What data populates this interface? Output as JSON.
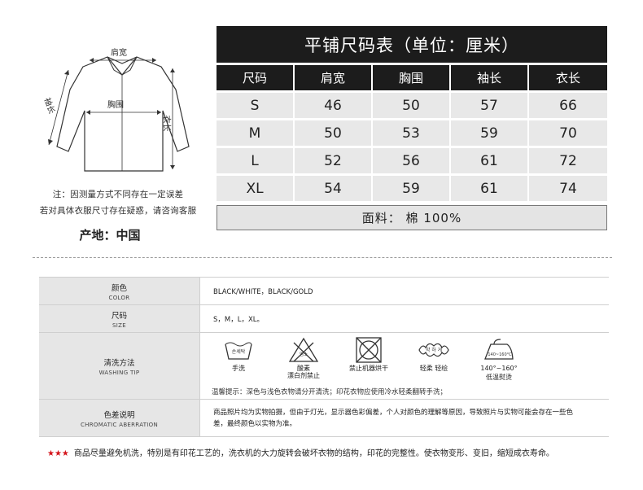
{
  "diagram": {
    "shoulder_label": "肩宽",
    "sleeve_label": "袖长",
    "chest_label": "胸围",
    "length_label": "衣长"
  },
  "notes": {
    "line1": "注：因测量方式不同存在一定误差",
    "line2": "若对具体衣服尺寸存在疑惑，请咨询客服",
    "origin": "产地：中国"
  },
  "size_table": {
    "title": "平铺尺码表（单位：厘米）",
    "headers": [
      "尺码",
      "肩宽",
      "胸围",
      "袖长",
      "衣长"
    ],
    "rows": [
      [
        "S",
        "46",
        "50",
        "57",
        "66"
      ],
      [
        "M",
        "50",
        "53",
        "59",
        "70"
      ],
      [
        "L",
        "52",
        "56",
        "61",
        "72"
      ],
      [
        "XL",
        "54",
        "59",
        "61",
        "74"
      ]
    ],
    "fabric": "面料： 棉  100%"
  },
  "info": {
    "color": {
      "zh": "颜色",
      "en": "COLOR",
      "value": "BLACK/WHITE，BLACK/GOLD"
    },
    "size": {
      "zh": "尺码",
      "en": "SIZE",
      "value": "S，M，L，XL。"
    },
    "washing": {
      "zh": "清洗方法",
      "en": "WASHING TIP",
      "icons": [
        {
          "icon": "hand-wash-icon",
          "tub_text": "손세탁",
          "caption": "手洗"
        },
        {
          "icon": "no-bleach-icon",
          "tri_text": "염소",
          "caption": "酸素\n漂白剂禁止"
        },
        {
          "icon": "no-tumble-dry-icon",
          "caption": "禁止机器烘干"
        },
        {
          "icon": "gentle-wring-icon",
          "twist_text": "약 하 게",
          "caption": "轻柔 轻绘"
        },
        {
          "icon": "low-iron-icon",
          "iron_text": "140~160°C",
          "temp": "140°~160°",
          "caption": "低温熨烫"
        }
      ],
      "tip": "温馨提示：深色与浅色衣物请分开清洗；印花衣物应使用冷水轻柔翻转手洗；"
    },
    "chromatic": {
      "zh": "色差说明",
      "en": "CHROMATIC ABERRATION",
      "value": "商品照片均为实物拍摄，但由于灯光，显示器色彩偏差，个人对颜色的理解等原因，导致照片与实物可能会存在一些色差，最终颜色以实物为准。"
    }
  },
  "footer": {
    "stars": "★★★",
    "text": "商品尽量避免机洗，特别是有印花工艺的，洗衣机的大力旋转会破坏衣物的结构，印花的完整性。使衣物变形、变旧，缩短成衣寿命。"
  },
  "colors": {
    "dark": "#1c1c1c",
    "cell": "#e8e8e8",
    "star": "#d4141b"
  }
}
